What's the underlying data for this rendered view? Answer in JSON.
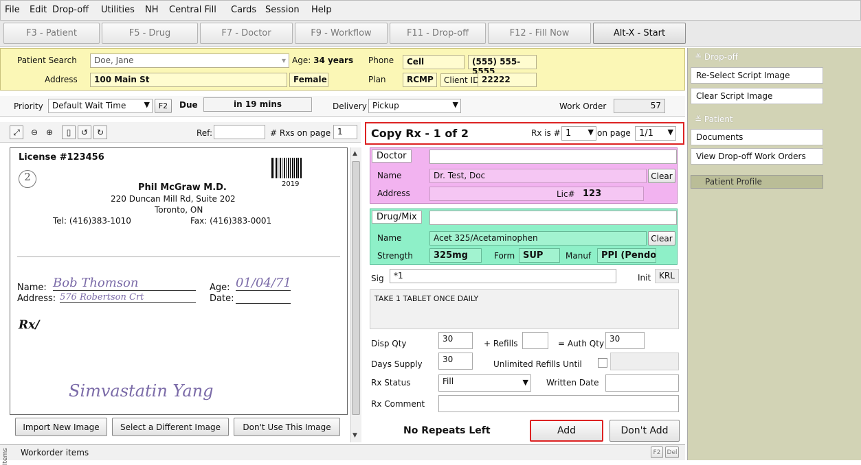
{
  "menu": [
    "File",
    "Edit",
    "Drop-off",
    "Utilities",
    "NH",
    "Central Fill",
    "Cards",
    "Session",
    "Help"
  ],
  "fkeys": [
    "F3 - Patient",
    "F5 - Drug",
    "F7 - Doctor",
    "F9 - Workflow",
    "F11 - Drop-off",
    "F12 - Fill Now",
    "Alt-X - Start"
  ],
  "patient": {
    "search_label": "Patient Search",
    "search_value": "Doe, Jane",
    "age_label": "Age:",
    "age_value": "34 years",
    "phone_label": "Phone",
    "phone_type": "Cell",
    "phone_number": "(555) 555-5555",
    "address_label": "Address",
    "address_value": "100 Main St",
    "gender": "Female",
    "plan_label": "Plan",
    "plan_value": "RCMP",
    "clientid_label": "Client ID",
    "clientid_value": "22222"
  },
  "priority": {
    "label": "Priority",
    "value": "Default Wait Time",
    "f2": "F2",
    "due_label": "Due",
    "due_value": "in 19 mins",
    "delivery_label": "Delivery",
    "delivery_value": "Pickup",
    "workorder_label": "Work Order",
    "workorder_value": "57"
  },
  "viewer": {
    "ref_label": "Ref:",
    "rxs_label": "# Rxs on page",
    "rxs_value": "1",
    "buttons": [
      "Import New Image",
      "Select a Different Image",
      "Don't Use This Image"
    ]
  },
  "script": {
    "license": "License #123456",
    "circle_num": "2",
    "doctor": "Phil McGraw M.D.",
    "addr1": "220 Duncan Mill Rd, Suite 202",
    "addr2": "Toronto, ON",
    "tel": "Tel: (416)383-1010",
    "fax": "Fax: (416)383-0001",
    "year": "2019",
    "name_label": "Name:",
    "name_value": "Bob Thomson",
    "age_label": "Age:",
    "age_value": "01/04/71",
    "address_label": "Address:",
    "address_value": "576 Robertson Crt",
    "date_label": "Date:",
    "rx": "Rx/",
    "signature": "Simvastatin Yang"
  },
  "rx": {
    "title": "Copy Rx - 1 of 2",
    "rxis_label": "Rx is #",
    "rxis_value": "1",
    "onpage_label": "on page",
    "onpage_value": "1/1",
    "doctor_title": "Doctor",
    "doctor_name_label": "Name",
    "doctor_name": "Dr. Test, Doc",
    "clear": "Clear",
    "doctor_address_label": "Address",
    "lic_label": "Lic#",
    "lic_value": "123",
    "drug_title": "Drug/Mix",
    "drug_name_label": "Name",
    "drug_name": "Acet 325/Acetaminophen",
    "strength_label": "Strength",
    "strength_value": "325mg",
    "form_label": "Form",
    "form_value": "SUP",
    "manuf_label": "Manuf",
    "manuf_value": "PPI (Pendo",
    "sig_label": "Sig",
    "sig_value": "*1",
    "init_label": "Init",
    "init_value": "KRL",
    "sig_text": "TAKE 1 TABLET ONCE DAILY",
    "disp_label": "Disp Qty",
    "disp_value": "30",
    "refills_label": "+ Refills",
    "authqty_label": "= Auth Qty",
    "authqty_value": "30",
    "days_label": "Days Supply",
    "days_value": "30",
    "unlimited_label": "Unlimited Refills Until",
    "status_label": "Rx Status",
    "status_value": "Fill",
    "written_label": "Written Date",
    "comment_label": "Rx Comment",
    "repeats": "No Repeats Left",
    "add": "Add",
    "dontadd": "Don't Add"
  },
  "sidebar": {
    "dropoff_title": "Drop-off",
    "dropoff_items": [
      "Re-Select Script Image",
      "Clear Script Image"
    ],
    "patient_title": "Patient",
    "patient_items": [
      "Documents",
      "View Drop-off Work Orders"
    ],
    "profile_title": "Patient Profile"
  },
  "status": {
    "side_label": "Items",
    "workorder_items": "Workorder items",
    "keys": [
      "F2",
      "Del"
    ]
  }
}
